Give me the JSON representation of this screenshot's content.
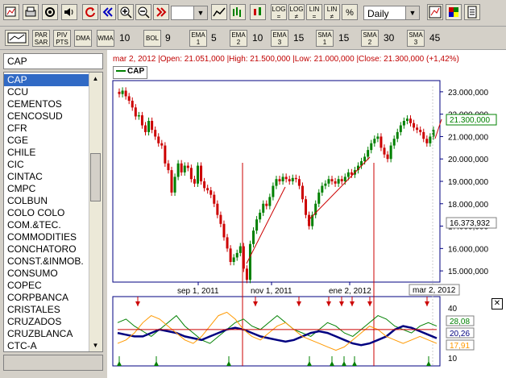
{
  "toolbar": {
    "period_value": "",
    "timeframe": "Daily",
    "btn_log_eq": "LOG\n=",
    "btn_log_neq": "LOG\n≠",
    "btn_lin_eq": "LIN\n=",
    "btn_lin_neq": "LIN\n≠",
    "btn_pct": "%",
    "icons": [
      "new-chart-icon",
      "print-icon",
      "settings-icon",
      "sound-icon",
      "refresh-icon",
      "rewind-icon",
      "zoom-in-icon",
      "zoom-out-icon",
      "fast-forward-icon",
      "line-chart-icon",
      "bar-chart-icon",
      "candle-chart-icon",
      "indicator-icon",
      "palette-icon",
      "notes-icon"
    ]
  },
  "params": {
    "par_sar": "PAR\nSAR",
    "piv_pts": "PIV\nPTS",
    "dma": "DMA",
    "wma": "WMA",
    "wma_val": "10",
    "bol": "BOL",
    "bol_val": "9",
    "ema1": "EMA\n1",
    "ema1_val": "5",
    "ema2": "EMA\n2",
    "ema2_val": "10",
    "ema3": "EMA\n3",
    "ema3_val": "15",
    "sma1": "SMA\n1",
    "sma1_val": "15",
    "sma2": "SMA\n2",
    "sma2_val": "30",
    "sma3": "SMA\n3",
    "sma3_val": "45"
  },
  "sidebar": {
    "search_value": "CAP",
    "items": [
      "CAP",
      "CCU",
      "CEMENTOS",
      "CENCOSUD",
      "CFR",
      "CGE",
      "CHILE",
      "CIC",
      "CINTAC",
      "CMPC",
      "COLBUN",
      "COLO COLO",
      "COM.&TEC.",
      "COMMODITIES",
      "CONCHATORO",
      "CONST.&INMOB.",
      "CONSUMO",
      "COPEC",
      "CORPBANCA",
      "CRISTALES",
      "CRUZADOS",
      "CRUZBLANCA",
      "CTC-A"
    ],
    "selected": "CAP"
  },
  "chart": {
    "header": "mar 2, 2012 |Open: 21.051,000 |High: 21.500,000 |Low: 21.000,000 |Close: 21.300,000 (+1,42%)",
    "legend": "CAP",
    "y_ticks": [
      "23.000,000",
      "22.000,000",
      "21.000,000",
      "20.000,000",
      "19.000,000",
      "18.000,000",
      "17.000,000",
      "16.000,000",
      "15.000,000"
    ],
    "x_ticks": [
      "sep 1, 2011",
      "nov 1, 2011",
      "ene 2, 2012"
    ],
    "current_label": "21.300,000",
    "cursor_label": "16.373,932",
    "date_label": "mar 2, 2012",
    "colors": {
      "up": "#008000",
      "down": "#cc0000",
      "axis": "#000080",
      "highlight": "#008000"
    }
  },
  "chart_data": {
    "type": "candlestick",
    "title": "CAP",
    "ylim": [
      14500000,
      23500000
    ],
    "x_ticks": [
      "sep 1, 2011",
      "nov 1, 2011",
      "ene 2, 2012"
    ],
    "close": [
      22900000,
      23050000,
      22800000,
      22600000,
      22300000,
      21900000,
      21950000,
      21500000,
      21200000,
      21700000,
      21300000,
      21000000,
      20700000,
      20600000,
      19800000,
      19500000,
      18500000,
      19200000,
      19800000,
      19400000,
      19700000,
      19600000,
      19100000,
      18900000,
      19700000,
      19000000,
      18700000,
      18600000,
      18400000,
      18000000,
      17500000,
      17100000,
      16500000,
      16000000,
      15400000,
      15600000,
      15800000,
      16100000,
      15100000,
      14600000,
      16200000,
      16800000,
      17300000,
      17600000,
      18000000,
      17900000,
      18300000,
      18800000,
      19100000,
      19000000,
      19200000,
      19100000,
      19000000,
      19150000,
      19100000,
      18800000,
      18200000,
      17500000,
      17000000,
      17500000,
      18000000,
      18500000,
      18800000,
      18900000,
      19100000,
      19000000,
      18900000,
      19100000,
      19000000,
      19200000,
      19400000,
      19300000,
      19500000,
      19700000,
      19900000,
      20100000,
      20400000,
      20700000,
      20900000,
      21000000,
      20500000,
      20200000,
      20000000,
      20600000,
      20900000,
      21200000,
      21500000,
      21700000,
      21800000,
      21600000,
      21400000,
      21300000,
      21200000,
      20900000,
      20700000,
      21000000,
      21300000
    ],
    "lower_panel": {
      "y_ticks": [
        "40",
        "10"
      ],
      "value_labels": [
        "28,08",
        "20,26",
        "17,91"
      ],
      "series_colors": [
        "#008000",
        "#000080",
        "#ff9900",
        "#cc0000"
      ]
    }
  }
}
